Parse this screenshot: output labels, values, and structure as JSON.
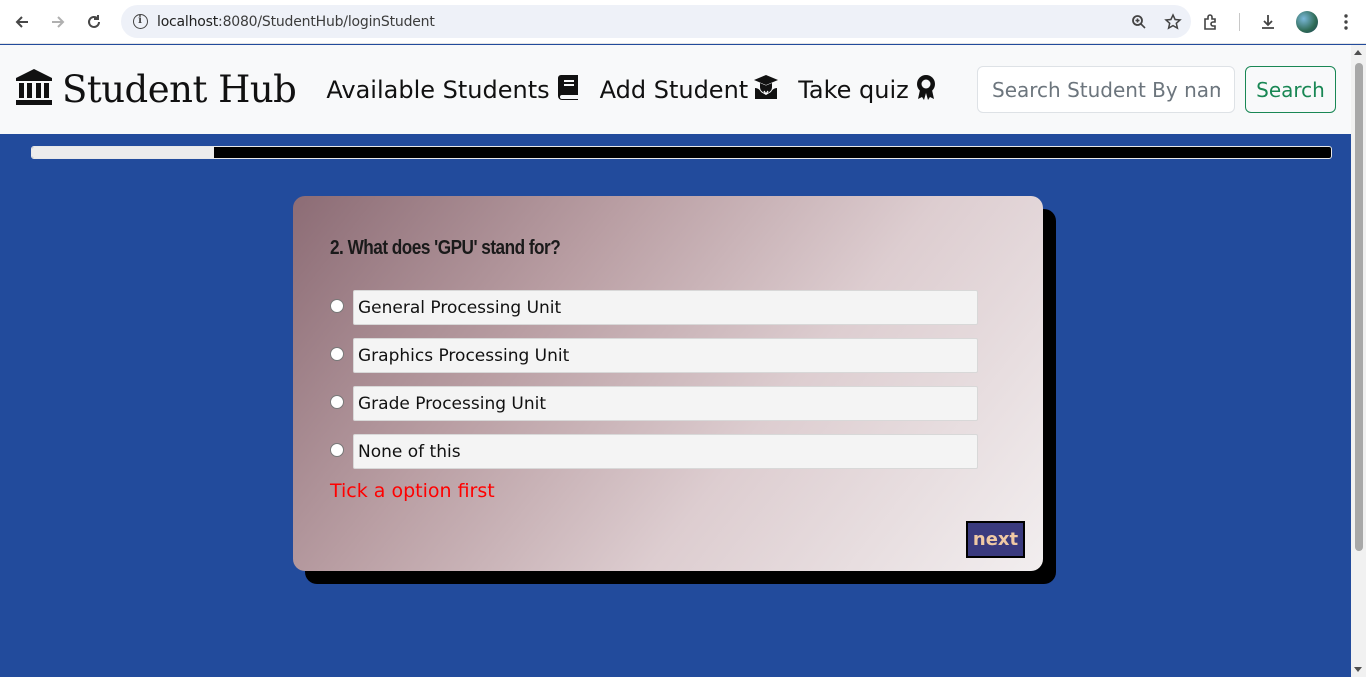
{
  "browser": {
    "url_host": "localhost",
    "url_path": ":8080/StudentHub/loginStudent"
  },
  "app": {
    "brand": "Student Hub",
    "nav": [
      {
        "label": "Available Students",
        "icon": "book-icon"
      },
      {
        "label": "Add Student",
        "icon": "graduate-icon"
      },
      {
        "label": "Take quiz",
        "icon": "award-icon"
      }
    ],
    "search": {
      "placeholder": "Search Student By name",
      "button_label": "Search"
    }
  },
  "quiz": {
    "progress_fraction": 0.14,
    "question": "2. What does 'GPU' stand for?",
    "options": [
      "General Processing Unit",
      "Graphics Processing Unit",
      "Grade Processing Unit",
      "None of this"
    ],
    "warning": "Tick a option first",
    "next_label": "next"
  },
  "colors": {
    "background": "#224b9c",
    "warning": "#ff0000",
    "next_button": "#3a3a7e",
    "search_accent": "#198754"
  }
}
